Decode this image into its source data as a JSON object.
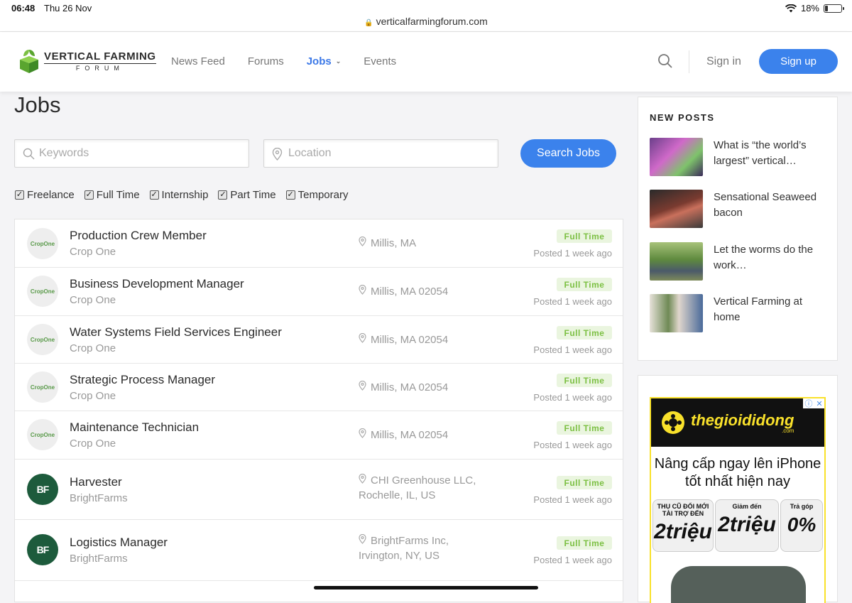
{
  "status_bar": {
    "time": "06:48",
    "date": "Thu 26 Nov",
    "url": "verticalfarmingforum.com",
    "battery": "18%"
  },
  "brand": {
    "name_line1": "VERTICAL FARMING",
    "name_line2": "FORUM",
    "accent": "#3b82ec",
    "badge_color": "#7cc043"
  },
  "nav": {
    "items": [
      "News Feed",
      "Forums",
      "Jobs",
      "Events"
    ],
    "active": "Jobs"
  },
  "header": {
    "sign_in": "Sign in",
    "sign_up": "Sign up"
  },
  "main": {
    "title": "Jobs",
    "keywords_placeholder": "Keywords",
    "location_placeholder": "Location",
    "search_button": "Search Jobs",
    "filters": [
      "Freelance",
      "Full Time",
      "Internship",
      "Part Time",
      "Temporary"
    ]
  },
  "jobs": [
    {
      "title": "Production Crew Member",
      "company": "Crop One",
      "location_line1": "Millis, MA",
      "location_line2": "",
      "type": "Full Time",
      "posted": "Posted 1 week ago",
      "logo": "CropOne"
    },
    {
      "title": "Business Development Manager",
      "company": "Crop One",
      "location_line1": "Millis, MA 02054",
      "location_line2": "",
      "type": "Full Time",
      "posted": "Posted 1 week ago",
      "logo": "CropOne"
    },
    {
      "title": "Water Systems Field Services Engineer",
      "company": "Crop One",
      "location_line1": "Millis, MA 02054",
      "location_line2": "",
      "type": "Full Time",
      "posted": "Posted 1 week ago",
      "logo": "CropOne"
    },
    {
      "title": "Strategic Process Manager",
      "company": "Crop One",
      "location_line1": "Millis, MA 02054",
      "location_line2": "",
      "type": "Full Time",
      "posted": "Posted 1 week ago",
      "logo": "CropOne"
    },
    {
      "title": "Maintenance Technician",
      "company": "Crop One",
      "location_line1": "Millis, MA 02054",
      "location_line2": "",
      "type": "Full Time",
      "posted": "Posted 1 week ago",
      "logo": "CropOne"
    },
    {
      "title": "Harvester",
      "company": "BrightFarms",
      "location_line1": "CHI Greenhouse LLC,",
      "location_line2": "Rochelle, IL, US",
      "type": "Full Time",
      "posted": "Posted 1 week ago",
      "logo": "BF"
    },
    {
      "title": "Logistics Manager",
      "company": "BrightFarms",
      "location_line1": "BrightFarms Inc,",
      "location_line2": "Irvington, NY, US",
      "type": "Full Time",
      "posted": "Posted 1 week ago",
      "logo": "BF"
    }
  ],
  "sidebar": {
    "heading": "NEW POSTS",
    "posts": [
      {
        "title": "What is “the world’s largest” vertical…"
      },
      {
        "title": "Sensational Seaweed bacon"
      },
      {
        "title": "Let the worms do the work…"
      },
      {
        "title": "Vertical Farming at home"
      }
    ]
  },
  "ad": {
    "brand": "thegioididong",
    "brand_suffix": ".com",
    "headline": "Nâng cấp ngay lên iPhone tốt nhất hiện nay",
    "box1_label": "THU CŨ ĐỔI MỚI TÀI TRỢ ĐẾN",
    "box1_value": "2triệu",
    "box2_label": "Giảm đến",
    "box2_value": "2triệu",
    "box3_label": "Trả góp",
    "box3_value": "0%"
  }
}
